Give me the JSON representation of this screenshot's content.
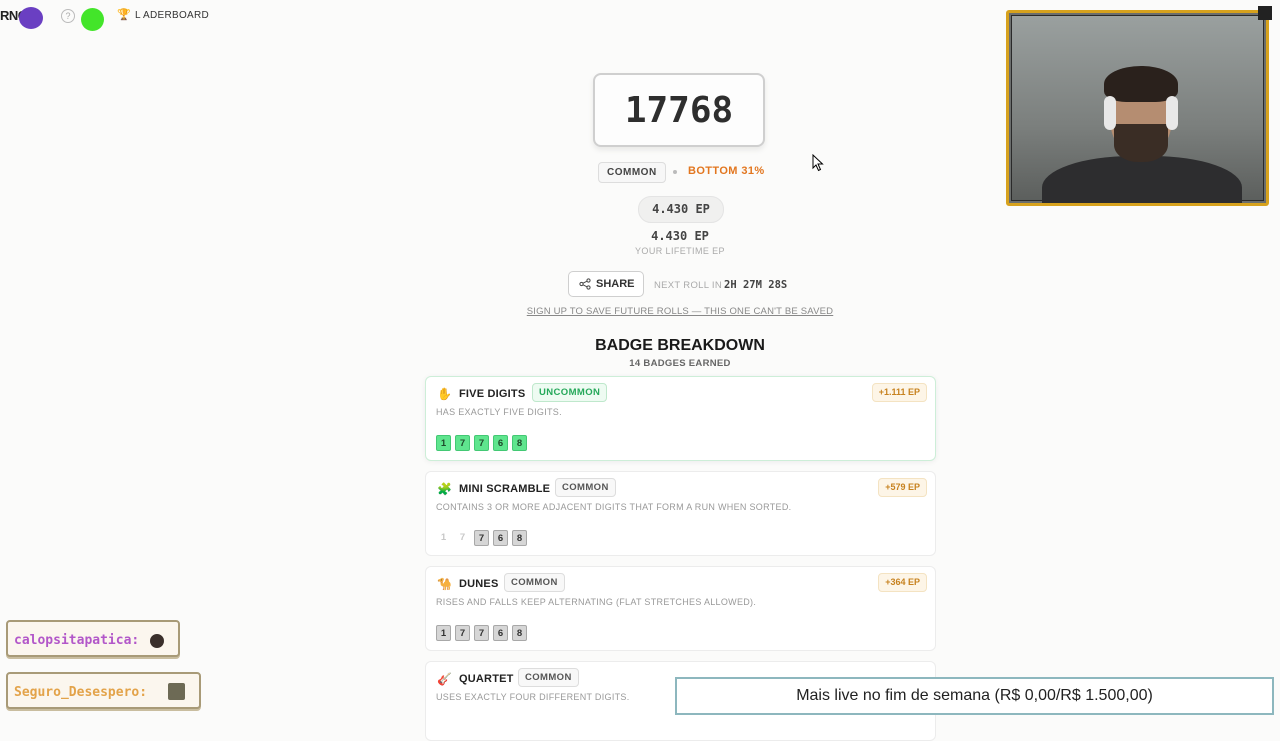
{
  "app": {
    "brand": "RNC",
    "leaderboard_label": "L ADERBOARD"
  },
  "result": {
    "number": "17768",
    "rarity": "COMMON",
    "percentile": "BOTTOM 31%",
    "ep_pill": "4.430 EP",
    "lifetime_ep": "4.430 EP",
    "lifetime_label": "YOUR LIFETIME EP",
    "share_label": "SHARE",
    "next_roll_label": "NEXT ROLL IN",
    "next_roll_time": "2H 27M 28S",
    "signup_link": "SIGN UP TO SAVE FUTURE ROLLS — THIS ONE CAN'T BE SAVED"
  },
  "breakdown": {
    "title": "BADGE BREAKDOWN",
    "subtitle": "14 BADGES EARNED",
    "badges": [
      {
        "icon": "✋",
        "name": "FIVE DIGITS",
        "rarity": "UNCOMMON",
        "ep": "+1.111 EP",
        "description": "HAS EXACTLY FIVE DIGITS.",
        "digits": [
          "1",
          "7",
          "7",
          "6",
          "8"
        ]
      },
      {
        "icon": "🧩",
        "name": "MINI SCRAMBLE",
        "rarity": "COMMON",
        "ep": "+579 EP",
        "description": "CONTAINS 3 OR MORE ADJACENT DIGITS THAT FORM A RUN WHEN SORTED.",
        "digits": [
          "1",
          "7",
          "7",
          "6",
          "8"
        ]
      },
      {
        "icon": "🐪",
        "name": "DUNES",
        "rarity": "COMMON",
        "ep": "+364 EP",
        "description": "RISES AND FALLS KEEP ALTERNATING (FLAT STRETCHES ALLOWED).",
        "digits": [
          "1",
          "7",
          "7",
          "6",
          "8"
        ]
      },
      {
        "icon": "🎸",
        "name": "QUARTET",
        "rarity": "COMMON",
        "ep": "",
        "description": "USES EXACTLY FOUR DIFFERENT DIGITS.",
        "digits": []
      }
    ]
  },
  "stream": {
    "chat": [
      {
        "user": "calopsitapatica:"
      },
      {
        "user": "Seguro_Desespero:"
      }
    ],
    "goal": "Mais live no fim de semana (R$ 0,00/R$ 1.500,00)"
  },
  "colors": {
    "accent_orange": "#e2761f",
    "uncommon_green": "#25a85a",
    "digit_highlight": "#5fe58e",
    "webcam_border": "#d7a21d"
  }
}
